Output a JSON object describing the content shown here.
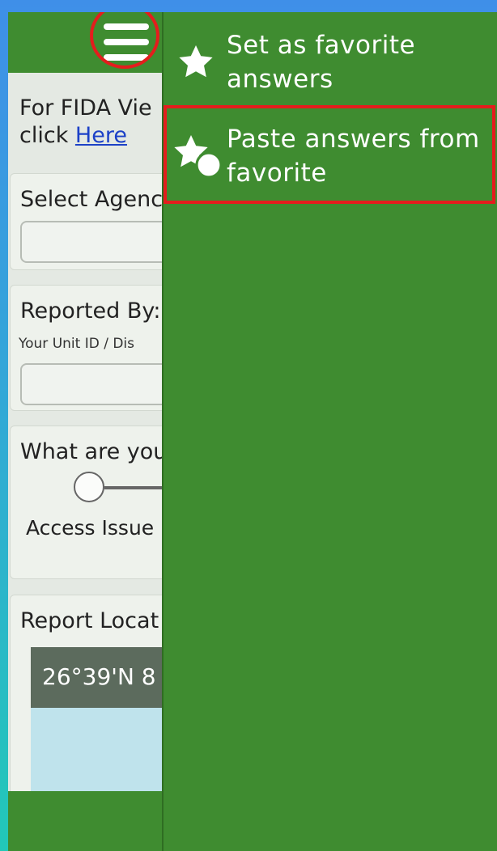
{
  "form": {
    "info_text": "For FIDA Vie",
    "info_click": "click",
    "info_link": "Here",
    "agency_label": "Select Agenc",
    "reported_by_label": "Reported By:",
    "reported_by_hint": "Your Unit ID / Dis",
    "question_label": "What are you",
    "option_access": "Access Issue",
    "location_label": "Report Locat",
    "map_coordinates": "26°39'N 8"
  },
  "menu": {
    "items": [
      {
        "label_line1": "Set as favorite",
        "label_line2": "answers",
        "icon": "star-icon"
      },
      {
        "label_line1": "Paste answers from",
        "label_line2": "favorite",
        "icon": "star-paste-icon"
      }
    ]
  },
  "colors": {
    "primary_green": "#3f8c30",
    "annotation_red": "#e41d1d",
    "link_blue": "#1c41c7"
  }
}
